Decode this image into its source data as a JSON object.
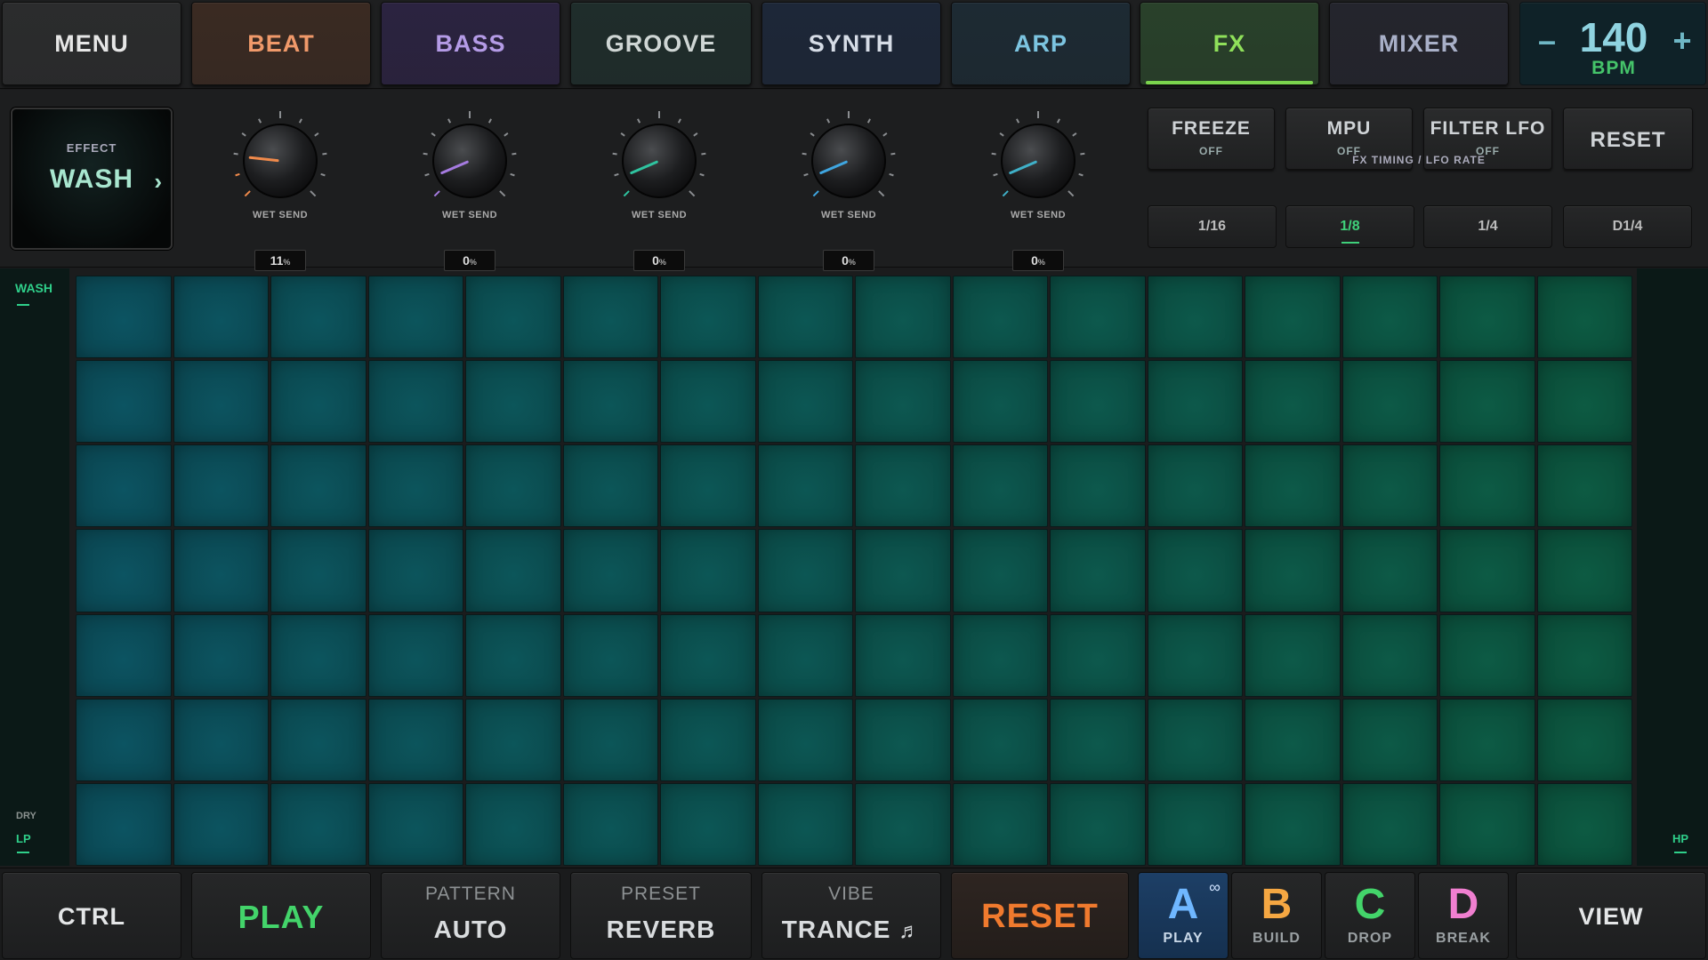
{
  "nav": {
    "tabs": [
      {
        "label": "MENU",
        "color": "#e6e6e6",
        "bg": "#2b2c2d"
      },
      {
        "label": "BEAT",
        "color": "#f0996a",
        "bg": "#3a2a22"
      },
      {
        "label": "BASS",
        "color": "#b49be6",
        "bg": "#2b2340"
      },
      {
        "label": "GROOVE",
        "color": "#cfd6d4",
        "bg": "#1f2d2b"
      },
      {
        "label": "SYNTH",
        "color": "#d6dce6",
        "bg": "#1d2738"
      },
      {
        "label": "ARP",
        "color": "#7cc4e0",
        "bg": "#1d2a33"
      },
      {
        "label": "FX",
        "color": "#8fe05a",
        "bg": "#29412a"
      },
      {
        "label": "MIXER",
        "color": "#a9b0c8",
        "bg": "#24252d"
      }
    ],
    "active_tab": "FX",
    "bpm": {
      "minus": "–",
      "plus": "+",
      "value": "140",
      "unit": "BPM"
    }
  },
  "fx": {
    "effect": {
      "label": "EFFECT",
      "name": "WASH",
      "chevron": "›"
    },
    "knobs": [
      {
        "label": "WET SEND",
        "value": "11",
        "unit": "%",
        "level": 0.11,
        "color": "#f08a4b"
      },
      {
        "label": "WET SEND",
        "value": "0",
        "unit": "%",
        "level": 0.0,
        "color": "#a57be0"
      },
      {
        "label": "WET SEND",
        "value": "0",
        "unit": "%",
        "level": 0.0,
        "color": "#2fc4a0"
      },
      {
        "label": "WET SEND",
        "value": "0",
        "unit": "%",
        "level": 0.0,
        "color": "#3fa6e0"
      },
      {
        "label": "WET SEND",
        "value": "0",
        "unit": "%",
        "level": 0.0,
        "color": "#3fb0c8"
      }
    ],
    "toggles": [
      {
        "title": "FREEZE",
        "state": "OFF"
      },
      {
        "title": "MPU",
        "state": "OFF"
      },
      {
        "title": "FILTER LFO",
        "state": "OFF"
      }
    ],
    "reset_label": "RESET",
    "timing_label": "FX TIMING / LFO RATE",
    "timing": [
      "1/16",
      "1/8",
      "1/4",
      "D1/4"
    ],
    "timing_active": "1/8"
  },
  "rail": {
    "top_label": "WASH",
    "dry_label": "DRY",
    "lp_label": "LP",
    "hp_label": "HP",
    "accent": "#2fcf8a"
  },
  "grid": {
    "rows": 7,
    "cols": 16,
    "color_left": "#0c5462",
    "color_right": "#0d5b43"
  },
  "bottom": {
    "ctrl": "CTRL",
    "play": "PLAY",
    "pattern": {
      "sub": "PATTERN",
      "value": "AUTO"
    },
    "preset": {
      "sub": "PRESET",
      "value": "REVERB"
    },
    "vibe": {
      "sub": "VIBE",
      "value": "TRANCE",
      "icon": "♬"
    },
    "reset": "RESET",
    "scenes": [
      {
        "letter": "A",
        "name": "PLAY",
        "color": "#6fb7ff"
      },
      {
        "letter": "B",
        "name": "BUILD",
        "color": "#f5a742"
      },
      {
        "letter": "C",
        "name": "DROP",
        "color": "#43d46a"
      },
      {
        "letter": "D",
        "name": "BREAK",
        "color": "#f07fd0"
      }
    ],
    "scene_active": "A",
    "loop_icon": "∞",
    "view": "VIEW"
  }
}
